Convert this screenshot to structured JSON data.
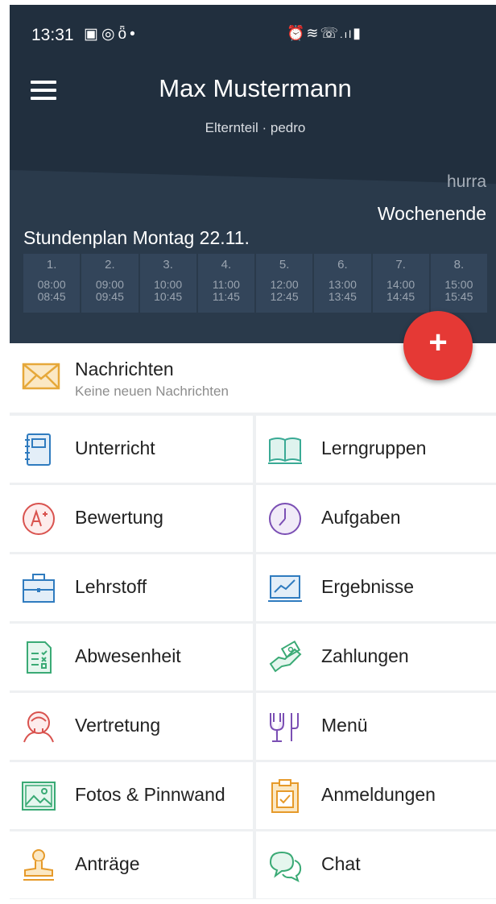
{
  "status_bar": {
    "time": "13:31",
    "left_icons": [
      "image-icon",
      "whatsapp-icon",
      "timer-icon",
      "dot-icon"
    ],
    "right_icons": [
      "alarm-icon",
      "wifi-icon",
      "wifi-call-icon",
      "signal-icon",
      "battery-icon"
    ]
  },
  "header": {
    "title": "Max Mustermann",
    "subtitle": "Elternteil · pedro",
    "note_small": "hurra",
    "note_big": "Wochenende",
    "schedule_title": "Stundenplan Montag 22.11.",
    "background_color": "#212f3e"
  },
  "periods": [
    {
      "num": "1.",
      "start": "08:00",
      "end": "08:45"
    },
    {
      "num": "2.",
      "start": "09:00",
      "end": "09:45"
    },
    {
      "num": "3.",
      "start": "10:00",
      "end": "10:45"
    },
    {
      "num": "4.",
      "start": "11:00",
      "end": "11:45"
    },
    {
      "num": "5.",
      "start": "12:00",
      "end": "12:45"
    },
    {
      "num": "6.",
      "start": "13:00",
      "end": "13:45"
    },
    {
      "num": "7.",
      "start": "14:00",
      "end": "14:45"
    },
    {
      "num": "8.",
      "start": "15:00",
      "end": "15:45"
    }
  ],
  "fab": {
    "label": "+",
    "color": "#e53935"
  },
  "messages": {
    "title": "Nachrichten",
    "subtitle": "Keine neuen Nachrichten",
    "icon": "envelope-icon"
  },
  "menu": [
    {
      "label": "Unterricht",
      "icon": "notebook-icon"
    },
    {
      "label": "Lerngruppen",
      "icon": "open-book-icon"
    },
    {
      "label": "Bewertung",
      "icon": "grade-icon"
    },
    {
      "label": "Aufgaben",
      "icon": "clock-icon"
    },
    {
      "label": "Lehrstoff",
      "icon": "briefcase-icon"
    },
    {
      "label": "Ergebnisse",
      "icon": "chart-icon"
    },
    {
      "label": "Abwesenheit",
      "icon": "checklist-icon"
    },
    {
      "label": "Zahlungen",
      "icon": "money-icon"
    },
    {
      "label": "Vertretung",
      "icon": "person-icon"
    },
    {
      "label": "Menü",
      "icon": "food-icon"
    },
    {
      "label": "Fotos & Pinnwand",
      "icon": "photo-icon"
    },
    {
      "label": "Anmeldungen",
      "icon": "clipboard-icon"
    },
    {
      "label": "Anträge",
      "icon": "stamp-icon"
    },
    {
      "label": "Chat",
      "icon": "chat-icon"
    }
  ]
}
